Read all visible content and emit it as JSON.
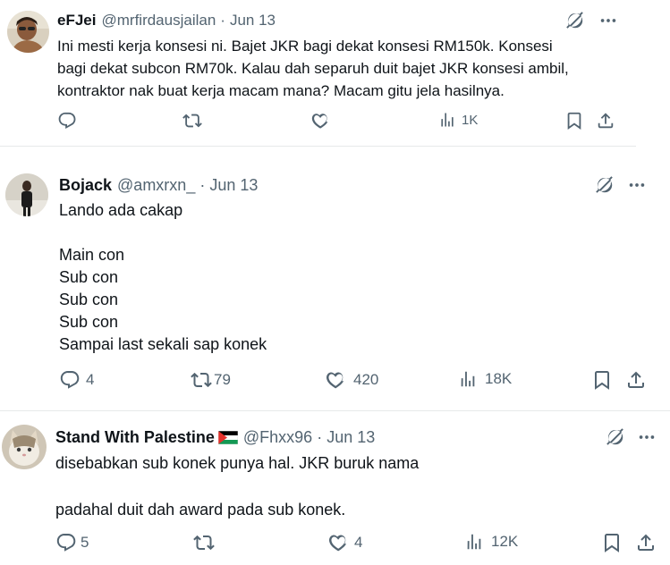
{
  "tweets": [
    {
      "name": "eFJei",
      "handle": "@mrfirdausjailan",
      "date": "Jun 13",
      "text": "Ini mesti kerja konsesi ni. Bajet JKR bagi dekat konsesi RM150k. Konsesi\nbagi dekat subcon RM70k. Kalau dah separuh duit bajet JKR konsesi ambil,\nkontraktor nak buat kerja macam mana? Macam gitu jela hasilnya.",
      "replies": "",
      "reposts": "",
      "likes": "",
      "views": "1K"
    },
    {
      "name": "Bojack",
      "handle": "@amxrxn_",
      "date": "Jun 13",
      "text": "Lando ada cakap\n\nMain con\nSub con\nSub con\nSub con\nSampai last sekali sap konek",
      "replies": "4",
      "reposts": "79",
      "likes": "420",
      "views": "18K"
    },
    {
      "name": "Stand With Palestine",
      "handle": "@Fhxx96",
      "date": "Jun 13",
      "text": "disebabkan sub konek punya hal. JKR buruk nama\n\npadahal duit dah award pada sub konek.",
      "replies": "5",
      "reposts": "",
      "likes": "4",
      "views": "12K"
    }
  ],
  "icons": {
    "grok": "grok-icon",
    "more": "more-icon",
    "reply": "reply-icon",
    "repost": "repost-icon",
    "like": "like-icon",
    "views": "views-icon",
    "bookmark": "bookmark-icon",
    "share": "share-icon",
    "flag": "palestine-flag-icon"
  },
  "colors": {
    "text": "#0f1419",
    "secondary": "#536471",
    "divider": "#e7e9ea"
  }
}
